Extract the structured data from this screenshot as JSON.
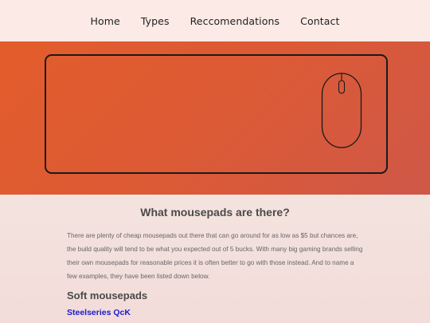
{
  "nav": {
    "items": [
      "Home",
      "Types",
      "Reccomendations",
      "Contact"
    ]
  },
  "hero": {
    "image_icon": "mousepad-with-mouse-illustration"
  },
  "section": {
    "title": "What mousepads are there?",
    "intro": "There are plenty of cheap mousepads out there that can go around for as low as $5 but chances are, the build quality will tend to be what you expected out of 5 bucks. With many big gaming brands selling their own mousepads for reasonable prices it is often better to go with those instead. And to name a few examples, they have been listed down below.",
    "subheading": "Soft mousepads",
    "first_item_link": "Steelseries QcK"
  },
  "colors": {
    "hero_gradient_start": "#e35c2b",
    "hero_gradient_end": "#cf5848",
    "nav_bg": "#fbeae6",
    "page_bg": "#f3dcd9",
    "link": "#1a1acc"
  }
}
